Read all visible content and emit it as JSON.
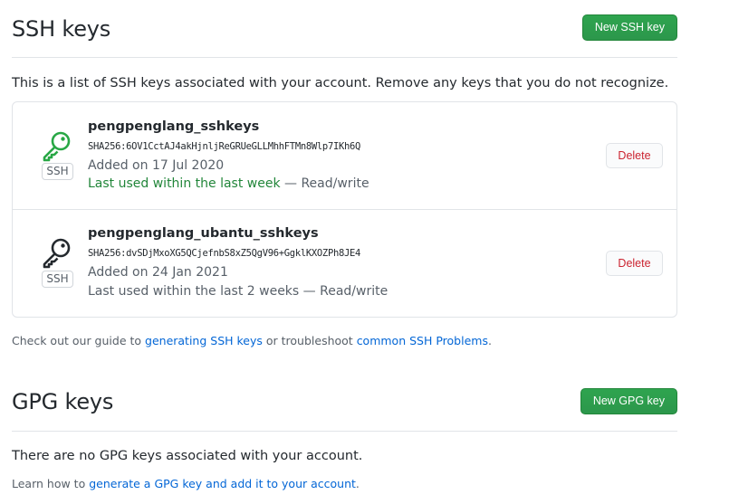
{
  "ssh": {
    "title": "SSH keys",
    "new_button": "New SSH key",
    "intro": "This is a list of SSH keys associated with your account. Remove any keys that you do not recognize.",
    "keys": [
      {
        "title": "pengpenglang_sshkeys",
        "fingerprint": "SHA256:6OV1CctAJ4akHjnljReGRUeGLLMhhFTMn8Wlp7IKh6Q",
        "added": "Added on 17 Jul 2020",
        "last_used": "Last used within the last week",
        "access": " — Read/write",
        "badge": "SSH",
        "delete_label": "Delete",
        "icon": "key-icon",
        "icon_color": "#28a745"
      },
      {
        "title": "pengpenglang_ubantu_sshkeys",
        "fingerprint": "SHA256:dvSDjMxoXG5QCjefnbS8xZ5QgV96+GgklKXOZPh8JE4",
        "added": "Added on 24 Jan 2021",
        "last_used": "Last used within the last 2 weeks",
        "access": " — Read/write",
        "badge": "SSH",
        "delete_label": "Delete",
        "icon": "key-icon",
        "icon_color": "#24292e"
      }
    ],
    "help": {
      "prefix": "Check out our guide to ",
      "link1": "generating SSH keys",
      "middle": " or troubleshoot ",
      "link2": "common SSH Problems",
      "suffix": "."
    }
  },
  "gpg": {
    "title": "GPG keys",
    "new_button": "New GPG key",
    "empty": "There are no GPG keys associated with your account.",
    "help": {
      "prefix": "Learn how to ",
      "link": "generate a GPG key and add it to your account",
      "suffix": "."
    }
  },
  "colors": {
    "primary_button": "#2ea44f",
    "danger": "#cb2431",
    "link": "#0366d6",
    "recent_use": "#22863a"
  }
}
